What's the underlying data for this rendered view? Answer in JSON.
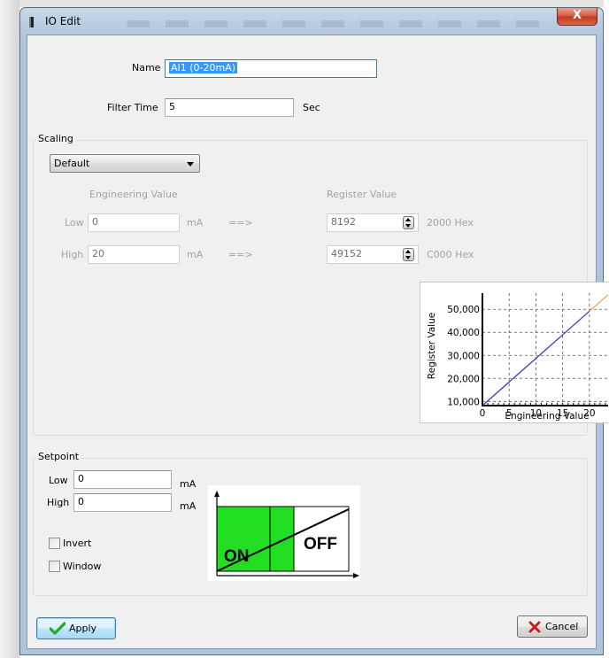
{
  "window": {
    "title": "IO Edit",
    "close_glyph": "X"
  },
  "name_field": {
    "label": "Name",
    "value": "AI1 (0-20mA)"
  },
  "filter_time": {
    "label": "Filter Time",
    "value": "5",
    "unit": "Sec"
  },
  "scaling": {
    "legend": "Scaling",
    "mode": "Default",
    "engineering_header": "Engineering Value",
    "register_header": "Register Value",
    "rows": [
      {
        "label": "Low",
        "eng_value": "0",
        "unit": "mA",
        "arrow": "==>",
        "reg_value": "8192",
        "hex": "2000 Hex"
      },
      {
        "label": "High",
        "eng_value": "20",
        "unit": "mA",
        "arrow": "==>",
        "reg_value": "49152",
        "hex": "C000 Hex"
      }
    ]
  },
  "chart_data": {
    "type": "line",
    "xlabel": "Engineering Value",
    "ylabel": "Register Value",
    "x_ticks": [
      "0",
      "5",
      "10",
      "15",
      "20"
    ],
    "y_ticks": [
      "10,000",
      "20,000",
      "30,000",
      "40,000",
      "50,000"
    ],
    "xlim": [
      0,
      23.5
    ],
    "ylim": [
      8192,
      57000
    ],
    "grid": true,
    "series": [
      {
        "x": [
          0,
          20
        ],
        "y": [
          8192,
          49152
        ],
        "color": "#2f2fd0"
      },
      {
        "x": [
          20,
          23.5
        ],
        "y": [
          49152,
          56320
        ],
        "color": "#f0a040"
      }
    ]
  },
  "setpoint": {
    "legend": "Setpoint",
    "low_label": "Low",
    "low_value": "0",
    "low_unit": "mA",
    "high_label": "High",
    "high_value": "0",
    "high_unit": "mA",
    "invert_label": "Invert",
    "window_label": "Window",
    "diagram": {
      "on_label": "ON",
      "off_label": "OFF",
      "on_color": "#22dd22"
    }
  },
  "buttons": {
    "apply": "Apply",
    "cancel": "Cancel"
  },
  "colors": {
    "apply_check": "#2aa52a",
    "cancel_x": "#c62020"
  }
}
